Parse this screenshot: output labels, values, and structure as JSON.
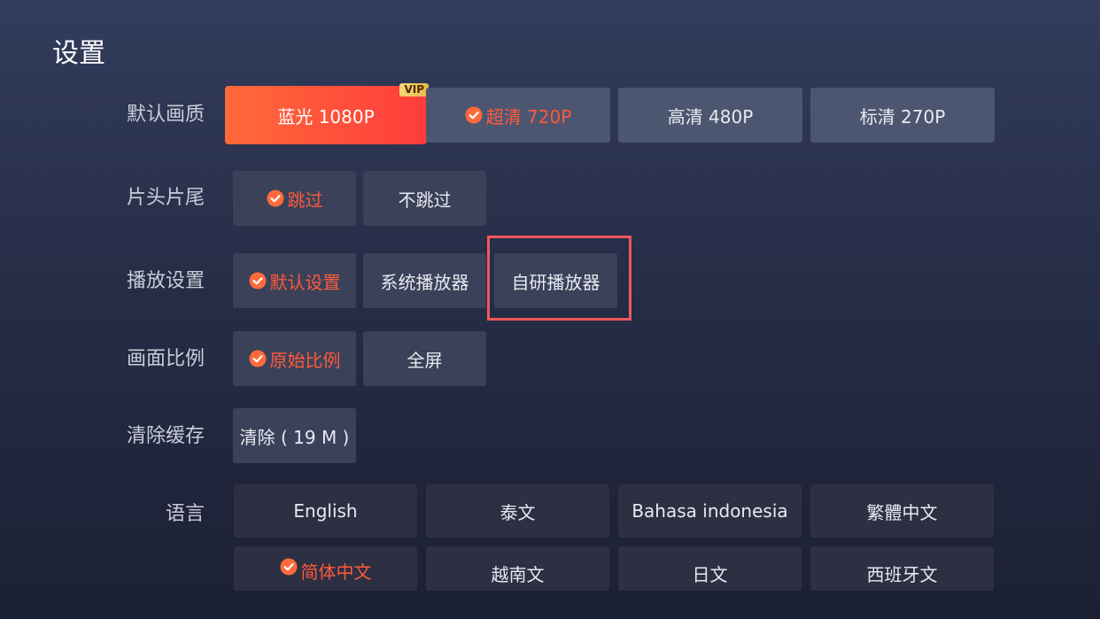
{
  "header": {
    "title": "设置"
  },
  "rows": {
    "quality": {
      "label": "默认画质",
      "options": [
        {
          "label": "蓝光 1080P",
          "badge": "VIP",
          "state": "focused"
        },
        {
          "label": "超清 720P",
          "state": "selected"
        },
        {
          "label": "高清 480P",
          "state": "normal"
        },
        {
          "label": "标清 270P",
          "state": "normal"
        }
      ]
    },
    "skip": {
      "label": "片头片尾",
      "options": [
        {
          "label": "跳过",
          "state": "selected"
        },
        {
          "label": "不跳过",
          "state": "normal"
        }
      ]
    },
    "player": {
      "label": "播放设置",
      "options": [
        {
          "label": "默认设置",
          "state": "selected"
        },
        {
          "label": "系统播放器",
          "state": "normal"
        },
        {
          "label": "自研播放器",
          "state": "highlighted"
        }
      ]
    },
    "ratio": {
      "label": "画面比例",
      "options": [
        {
          "label": "原始比例",
          "state": "selected"
        },
        {
          "label": "全屏",
          "state": "normal"
        }
      ]
    },
    "cache": {
      "label": "清除缓存",
      "options": [
        {
          "label": "清除 ( 19 M )",
          "state": "normal"
        }
      ]
    },
    "language": {
      "label": "语言",
      "options": [
        {
          "label": "English",
          "state": "normal"
        },
        {
          "label": "泰文",
          "state": "normal"
        },
        {
          "label": "Bahasa indonesia",
          "state": "normal"
        },
        {
          "label": "繁體中文",
          "state": "normal"
        },
        {
          "label": "简体中文",
          "state": "selected"
        },
        {
          "label": "越南文",
          "state": "normal"
        },
        {
          "label": "日文",
          "state": "normal"
        },
        {
          "label": "西班牙文",
          "state": "normal"
        }
      ]
    }
  },
  "icons": {
    "selected": "check-circle-icon"
  },
  "colors": {
    "accent": "#ff5a3c",
    "focus_gradient_start": "#ff6a3a",
    "focus_gradient_end": "#ff3c3c",
    "vip_badge": "#f0c95e",
    "highlight_frame": "#f0575b",
    "option_bg": "#4d5670"
  }
}
